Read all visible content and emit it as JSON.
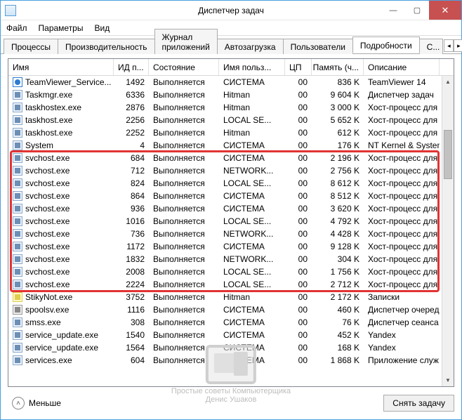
{
  "window": {
    "title": "Диспетчер задач"
  },
  "menu": {
    "file": "Файл",
    "options": "Параметры",
    "view": "Вид"
  },
  "tabs": {
    "processes": "Процессы",
    "performance": "Производительность",
    "apphistory": "Журнал приложений",
    "startup": "Автозагрузка",
    "users": "Пользователи",
    "details": "Подробности",
    "services_cut": "С..."
  },
  "columns": {
    "name": "Имя",
    "pid": "ИД п...",
    "state": "Состояние",
    "user": "Имя польз...",
    "cpu": "ЦП",
    "mem": "Память (ч...",
    "desc": "Описание"
  },
  "footer": {
    "less": "Меньше",
    "end_task": "Снять задачу"
  },
  "watermark": {
    "line1": "Простые советы Компьютерщика",
    "line2": "Денис Ушаков"
  },
  "rows": [
    {
      "icon": "tv",
      "name": "TeamViewer_Service...",
      "pid": "1492",
      "state": "Выполняется",
      "user": "СИСТЕМА",
      "cpu": "00",
      "mem": "836 K",
      "desc": "TeamViewer 14"
    },
    {
      "icon": "std",
      "name": "Taskmgr.exe",
      "pid": "6336",
      "state": "Выполняется",
      "user": "Hitman",
      "cpu": "00",
      "mem": "9 604 K",
      "desc": "Диспетчер задач"
    },
    {
      "icon": "std",
      "name": "taskhostex.exe",
      "pid": "2876",
      "state": "Выполняется",
      "user": "Hitman",
      "cpu": "00",
      "mem": "3 000 K",
      "desc": "Хост-процесс для з..."
    },
    {
      "icon": "std",
      "name": "taskhost.exe",
      "pid": "2256",
      "state": "Выполняется",
      "user": "LOCAL SE...",
      "cpu": "00",
      "mem": "5 652 K",
      "desc": "Хост-процесс для з..."
    },
    {
      "icon": "std",
      "name": "taskhost.exe",
      "pid": "2252",
      "state": "Выполняется",
      "user": "Hitman",
      "cpu": "00",
      "mem": "612 K",
      "desc": "Хост-процесс для з..."
    },
    {
      "icon": "std",
      "name": "System",
      "pid": "4",
      "state": "Выполняется",
      "user": "СИСТЕМА",
      "cpu": "00",
      "mem": "176 K",
      "desc": "NT Kernel & System"
    },
    {
      "icon": "std",
      "name": "svchost.exe",
      "pid": "684",
      "state": "Выполняется",
      "user": "СИСТЕМА",
      "cpu": "00",
      "mem": "2 196 K",
      "desc": "Хост-процесс для с..."
    },
    {
      "icon": "std",
      "name": "svchost.exe",
      "pid": "712",
      "state": "Выполняется",
      "user": "NETWORK...",
      "cpu": "00",
      "mem": "2 756 K",
      "desc": "Хост-процесс для с..."
    },
    {
      "icon": "std",
      "name": "svchost.exe",
      "pid": "824",
      "state": "Выполняется",
      "user": "LOCAL SE...",
      "cpu": "00",
      "mem": "8 612 K",
      "desc": "Хост-процесс для с..."
    },
    {
      "icon": "std",
      "name": "svchost.exe",
      "pid": "864",
      "state": "Выполняется",
      "user": "СИСТЕМА",
      "cpu": "00",
      "mem": "8 512 K",
      "desc": "Хост-процесс для с..."
    },
    {
      "icon": "std",
      "name": "svchost.exe",
      "pid": "936",
      "state": "Выполняется",
      "user": "СИСТЕМА",
      "cpu": "00",
      "mem": "3 620 K",
      "desc": "Хост-процесс для с..."
    },
    {
      "icon": "std",
      "name": "svchost.exe",
      "pid": "1016",
      "state": "Выполняется",
      "user": "LOCAL SE...",
      "cpu": "00",
      "mem": "4 792 K",
      "desc": "Хост-процесс для с..."
    },
    {
      "icon": "std",
      "name": "svchost.exe",
      "pid": "736",
      "state": "Выполняется",
      "user": "NETWORK...",
      "cpu": "00",
      "mem": "4 428 K",
      "desc": "Хост-процесс для с..."
    },
    {
      "icon": "std",
      "name": "svchost.exe",
      "pid": "1172",
      "state": "Выполняется",
      "user": "СИСТЕМА",
      "cpu": "00",
      "mem": "9 128 K",
      "desc": "Хост-процесс для с..."
    },
    {
      "icon": "std",
      "name": "svchost.exe",
      "pid": "1832",
      "state": "Выполняется",
      "user": "NETWORK...",
      "cpu": "00",
      "mem": "304 K",
      "desc": "Хост-процесс для с..."
    },
    {
      "icon": "std",
      "name": "svchost.exe",
      "pid": "2008",
      "state": "Выполняется",
      "user": "LOCAL SE...",
      "cpu": "00",
      "mem": "1 756 K",
      "desc": "Хост-процесс для с..."
    },
    {
      "icon": "std",
      "name": "svchost.exe",
      "pid": "2224",
      "state": "Выполняется",
      "user": "LOCAL SE...",
      "cpu": "00",
      "mem": "2 712 K",
      "desc": "Хост-процесс для с..."
    },
    {
      "icon": "note",
      "name": "StikyNot.exe",
      "pid": "3752",
      "state": "Выполняется",
      "user": "Hitman",
      "cpu": "00",
      "mem": "2 172 K",
      "desc": "Записки"
    },
    {
      "icon": "print",
      "name": "spoolsv.exe",
      "pid": "1116",
      "state": "Выполняется",
      "user": "СИСТЕМА",
      "cpu": "00",
      "mem": "460 K",
      "desc": "Диспетчер очереди..."
    },
    {
      "icon": "std",
      "name": "smss.exe",
      "pid": "308",
      "state": "Выполняется",
      "user": "СИСТЕМА",
      "cpu": "00",
      "mem": "76 K",
      "desc": "Диспетчер сеанса ..."
    },
    {
      "icon": "std",
      "name": "service_update.exe",
      "pid": "1540",
      "state": "Выполняется",
      "user": "СИСТЕМА",
      "cpu": "00",
      "mem": "452 K",
      "desc": "Yandex"
    },
    {
      "icon": "std",
      "name": "service_update.exe",
      "pid": "1564",
      "state": "Выполняется",
      "user": "СИСТЕМА",
      "cpu": "00",
      "mem": "168 K",
      "desc": "Yandex"
    },
    {
      "icon": "std",
      "name": "services.exe",
      "pid": "604",
      "state": "Выполняется",
      "user": "СИСТЕМА",
      "cpu": "00",
      "mem": "1 868 K",
      "desc": "Приложение служ..."
    }
  ]
}
